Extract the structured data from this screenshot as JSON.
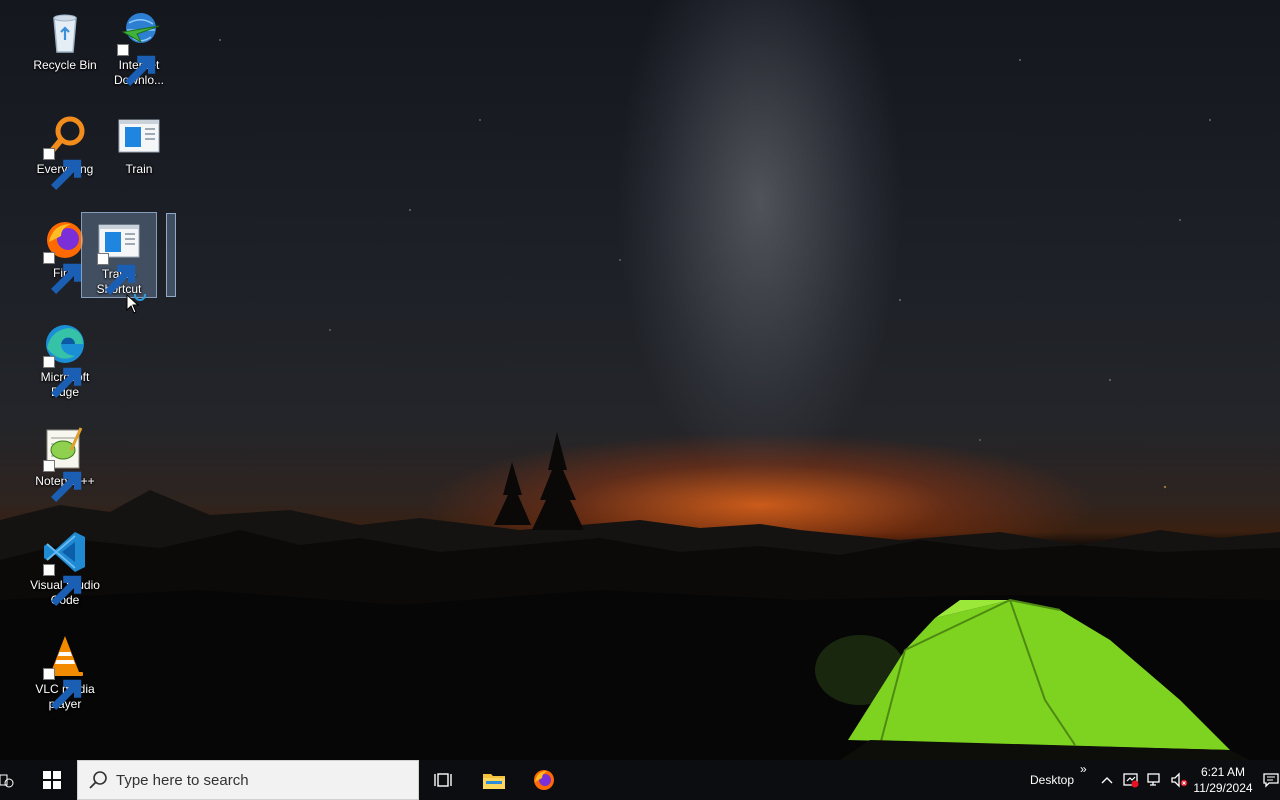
{
  "desktop": {
    "icons": [
      {
        "label": "Recycle Bin",
        "icon": "recycle-bin-icon"
      },
      {
        "label": "Internet Downlo...",
        "icon": "internet-download-manager-icon"
      },
      {
        "label": "Everything",
        "icon": "everything-search-icon"
      },
      {
        "label": "Train",
        "icon": "train-app-icon"
      },
      {
        "label": "Firef",
        "icon": "firefox-icon"
      },
      {
        "label": "Train - Shortcut",
        "icon": "train-shortcut-icon"
      },
      {
        "label": "Microsoft Edge",
        "icon": "edge-icon"
      },
      {
        "label": "Notepad++",
        "icon": "notepad-plus-plus-icon"
      },
      {
        "label": "Visual Studio Code",
        "icon": "vscode-icon"
      },
      {
        "label": "VLC media player",
        "icon": "vlc-icon"
      }
    ],
    "selected_icon": "Train - Shortcut"
  },
  "taskbar": {
    "search_placeholder": "Type here to search",
    "pinned": [
      "start-icon",
      "task-view-icon",
      "file-explorer-icon",
      "firefox-icon"
    ],
    "toolbar_label": "Desktop",
    "toolbar_chevron": "»",
    "tray_icons": [
      "show-hidden-icons-icon",
      "security-icon",
      "network-icon",
      "volume-muted-icon"
    ],
    "time": "6:21 AM",
    "date": "11/29/2024"
  },
  "colors": {
    "taskbar": "#0c0d10",
    "selection": "#7896b9",
    "tent": "#7ed321",
    "horizon_glow": "#ff6e19"
  }
}
